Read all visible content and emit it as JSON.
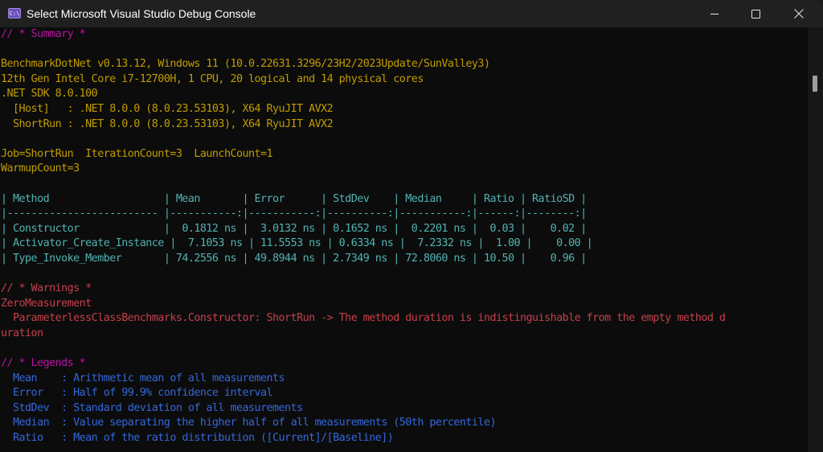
{
  "window": {
    "title": "Select Microsoft Visual Studio Debug Console",
    "icon": "console-app-icon",
    "icon_glyph": "C:\\",
    "controls": {
      "minimize": "minimize-icon",
      "maximize": "maximize-icon",
      "close": "close-icon"
    }
  },
  "colors": {
    "section_header": "#b5179e",
    "environment": "#c19c00",
    "table": "#61d6d6",
    "warning": "#e74856",
    "legend": "#3b78ff",
    "background": "#0c0c0c"
  },
  "console": {
    "summary_header": "// * Summary *",
    "environment": [
      "BenchmarkDotNet v0.13.12, Windows 11 (10.0.22631.3296/23H2/2023Update/SunValley3)",
      "12th Gen Intel Core i7-12700H, 1 CPU, 20 logical and 14 physical cores",
      ".NET SDK 8.0.100",
      "  [Host]   : .NET 8.0.0 (8.0.23.53103), X64 RyuJIT AVX2",
      "  ShortRun : .NET 8.0.0 (8.0.23.53103), X64 RyuJIT AVX2"
    ],
    "job": [
      "Job=ShortRun  IterationCount=3  LaunchCount=1",
      "WarmupCount=3"
    ],
    "table": {
      "header": "| Method                   | Mean       | Error      | StdDev    | Median     | Ratio | RatioSD |",
      "separator": "|------------------------- |-----------:|-----------:|----------:|-----------:|------:|--------:|",
      "columns": [
        "Method",
        "Mean",
        "Error",
        "StdDev",
        "Median",
        "Ratio",
        "RatioSD"
      ],
      "rows": [
        {
          "method": "Constructor",
          "mean": "0.1812 ns",
          "error": "3.0132 ns",
          "stddev": "0.1652 ns",
          "median": "0.2201 ns",
          "ratio": "0.03",
          "ratiosd": "0.02",
          "line": "| Constructor              |  0.1812 ns |  3.0132 ns | 0.1652 ns |  0.2201 ns |  0.03 |    0.02 |"
        },
        {
          "method": "Activator_Create_Instance",
          "mean": "7.1053 ns",
          "error": "11.5553 ns",
          "stddev": "0.6334 ns",
          "median": "7.2332 ns",
          "ratio": "1.00",
          "ratiosd": "0.00",
          "line": "| Activator_Create_Instance |  7.1053 ns | 11.5553 ns | 0.6334 ns |  7.2332 ns |  1.00 |    0.00 |"
        },
        {
          "method": "Type_Invoke_Member",
          "mean": "74.2556 ns",
          "error": "49.8944 ns",
          "stddev": "2.7349 ns",
          "median": "72.8060 ns",
          "ratio": "10.50",
          "ratiosd": "0.96",
          "line": "| Type_Invoke_Member       | 74.2556 ns | 49.8944 ns | 2.7349 ns | 72.8060 ns | 10.50 |    0.96 |"
        }
      ]
    },
    "warnings_header": "// * Warnings *",
    "warnings": [
      "ZeroMeasurement",
      "  ParameterlessClassBenchmarks.Constructor: ShortRun -> The method duration is indistinguishable from the empty method d",
      "uration"
    ],
    "legends_header": "// * Legends *",
    "legends": [
      "  Mean    : Arithmetic mean of all measurements",
      "  Error   : Half of 99.9% confidence interval",
      "  StdDev  : Standard deviation of all measurements",
      "  Median  : Value separating the higher half of all measurements (50th percentile)",
      "  Ratio   : Mean of the ratio distribution ([Current]/[Baseline])"
    ]
  }
}
